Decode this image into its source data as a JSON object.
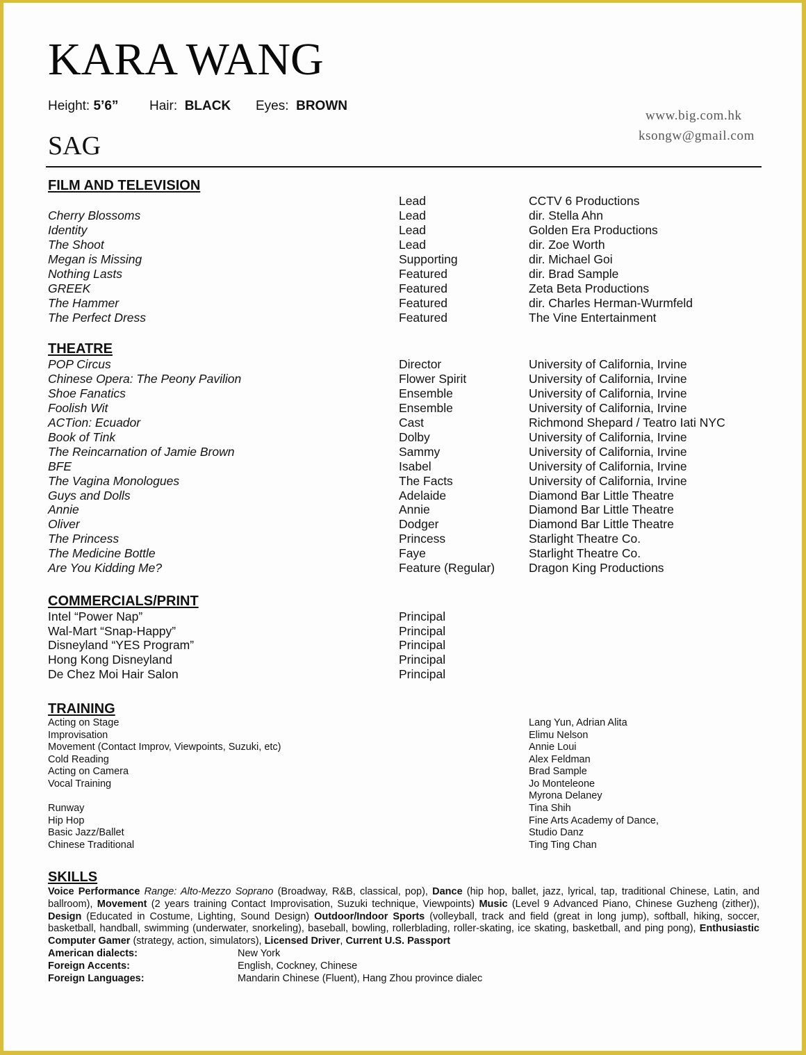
{
  "header": {
    "name": "KARA WANG",
    "stats": [
      {
        "label": "Height:",
        "value": "5’6”"
      },
      {
        "label": "Hair:",
        "value": "BLACK"
      },
      {
        "label": "Eyes:",
        "value": "BROWN"
      }
    ],
    "union": "SAG",
    "website": "www.big.com.hk",
    "email": "ksongw@gmail.com"
  },
  "film_tv": {
    "heading": "FILM AND TELEVISION",
    "rows": [
      {
        "title": "",
        "role": "Lead",
        "company": "CCTV 6 Productions"
      },
      {
        "title": "Cherry Blossoms",
        "role": "Lead",
        "company": "dir. Stella Ahn"
      },
      {
        "title": "Identity",
        "role": "Lead",
        "company": "Golden Era Productions"
      },
      {
        "title": "The Shoot",
        "role": "Lead",
        "company": "dir. Zoe Worth"
      },
      {
        "title": "Megan is Missing",
        "role": "Supporting",
        "company": "dir. Michael Goi"
      },
      {
        "title": "Nothing Lasts",
        "role": "Featured",
        "company": "dir. Brad Sample"
      },
      {
        "title": "GREEK",
        "role": "Featured",
        "company": "Zeta Beta Productions"
      },
      {
        "title": "The Hammer",
        "role": "Featured",
        "company": "dir. Charles Herman-Wurmfeld"
      },
      {
        "title": "The Perfect Dress",
        "role": "Featured",
        "company": "The Vine Entertainment"
      }
    ]
  },
  "theatre": {
    "heading": "THEATRE",
    "rows": [
      {
        "title": "POP Circus",
        "role": "Director",
        "company": "University of California, Irvine"
      },
      {
        "title": "Chinese Opera: The Peony Pavilion",
        "role": "Flower Spirit",
        "company": "University of California, Irvine"
      },
      {
        "title": "Shoe Fanatics",
        "role": "Ensemble",
        "company": "University of California, Irvine"
      },
      {
        "title": "Foolish Wit",
        "role": "Ensemble",
        "company": "University of California, Irvine"
      },
      {
        "title": "ACTion: Ecuador",
        "role": "Cast",
        "company": "Richmond Shepard / Teatro Iati NYC"
      },
      {
        "title": "Book of Tink",
        "role": "Dolby",
        "company": "University of California, Irvine"
      },
      {
        "title": "The Reincarnation of Jamie Brown",
        "role": "Sammy",
        "company": "University of California, Irvine"
      },
      {
        "title": "BFE",
        "role": "Isabel",
        "company": "University of California, Irvine"
      },
      {
        "title": "The Vagina Monologues",
        "role": "The Facts",
        "company": "University of California, Irvine"
      },
      {
        "title": "Guys and Dolls",
        "role": "Adelaide",
        "company": "Diamond Bar Little Theatre"
      },
      {
        "title": "Annie",
        "role": "Annie",
        "company": "Diamond Bar Little Theatre"
      },
      {
        "title": "Oliver",
        "role": "Dodger",
        "company": "Diamond Bar Little Theatre"
      },
      {
        "title": "The Princess",
        "role": "Princess",
        "company": "Starlight Theatre Co."
      },
      {
        "title": "The Medicine Bottle",
        "role": "Faye",
        "company": "Starlight Theatre Co."
      },
      {
        "title": "Are You Kidding Me?",
        "role": "Feature (Regular)",
        "company": "Dragon King Productions"
      }
    ]
  },
  "commercials": {
    "heading": "COMMERCIALS/PRINT",
    "rows": [
      {
        "title": "Intel “Power Nap”",
        "role": "Principal"
      },
      {
        "title": "Wal-Mart “Snap-Happy”",
        "role": "Principal"
      },
      {
        "title": "Disneyland “YES Program”",
        "role": "Principal"
      },
      {
        "title": "Hong Kong Disneyland",
        "role": "Principal"
      },
      {
        "title": "De Chez Moi Hair Salon",
        "role": "Principal"
      }
    ]
  },
  "training": {
    "heading": "TRAINING",
    "rows": [
      {
        "course": "Acting on Stage",
        "teacher": "Lang Yun, Adrian Alita"
      },
      {
        "course": "Improvisation",
        "teacher": "Elimu Nelson"
      },
      {
        "course": "Movement (Contact Improv, Viewpoints, Suzuki, etc)",
        "teacher": "Annie Loui"
      },
      {
        "course": "Cold Reading",
        "teacher": "Alex Feldman"
      },
      {
        "course": "Acting on Camera",
        "teacher": "Brad Sample"
      },
      {
        "course": "Vocal Training",
        "teacher": "Jo Monteleone"
      },
      {
        "course": "",
        "teacher": "Myrona Delaney"
      },
      {
        "course": "Runway",
        "teacher": "Tina Shih"
      },
      {
        "course": "Hip Hop",
        "teacher": "Fine Arts Academy of Dance,"
      },
      {
        "course": "Basic Jazz/Ballet",
        "teacher": "Studio Danz"
      },
      {
        "course": "Chinese Traditional",
        "teacher": "Ting Ting Chan"
      }
    ]
  },
  "skills": {
    "heading": "SKILLS",
    "segments": [
      {
        "text": "Voice Performance",
        "style": "bold"
      },
      {
        "text": " ",
        "style": "normal"
      },
      {
        "text": "Range: Alto-Mezzo Soprano",
        "style": "italic"
      },
      {
        "text": " (Broadway, R&B, classical, pop), ",
        "style": "normal"
      },
      {
        "text": "Dance",
        "style": "bold"
      },
      {
        "text": " (hip hop, ballet, jazz, lyrical, tap, traditional Chinese, Latin, and ballroom), ",
        "style": "normal"
      },
      {
        "text": "Movement",
        "style": "bold"
      },
      {
        "text": " (2 years training Contact Improvisation, Suzuki technique, Viewpoints) ",
        "style": "normal"
      },
      {
        "text": "Music",
        "style": "bold"
      },
      {
        "text": " (Level 9 Advanced Piano, Chinese Guzheng (zither)), ",
        "style": "normal"
      },
      {
        "text": "Design",
        "style": "bold"
      },
      {
        "text": " (Educated in Costume, Lighting, Sound Design) ",
        "style": "normal"
      },
      {
        "text": "Outdoor/Indoor Sports",
        "style": "bold"
      },
      {
        "text": " (volleyball, track and field (great in long jump), softball, hiking, soccer, basketball, handball, swimming (underwater, snorkeling), baseball, bowling, rollerblading, roller-skating, ice skating, basketball, and ping pong), ",
        "style": "normal"
      },
      {
        "text": "Enthusiastic Computer Gamer",
        "style": "bold"
      },
      {
        "text": " (strategy, action, simulators), ",
        "style": "normal"
      },
      {
        "text": "Licensed Driver",
        "style": "bold"
      },
      {
        "text": ", ",
        "style": "normal"
      },
      {
        "text": "Current U.S. Passport",
        "style": "bold"
      }
    ],
    "details": [
      {
        "label": "American dialects:",
        "value": "New York"
      },
      {
        "label": "Foreign Accents:",
        "value": "English, Cockney, Chinese"
      },
      {
        "label": "Foreign Languages:",
        "value": "Mandarin Chinese (Fluent), Hang Zhou province dialec"
      }
    ]
  },
  "colors": {
    "frame": "#d9be3c",
    "paper": "#fdfdfd",
    "text": "#111111",
    "contact_text": "#555555"
  }
}
